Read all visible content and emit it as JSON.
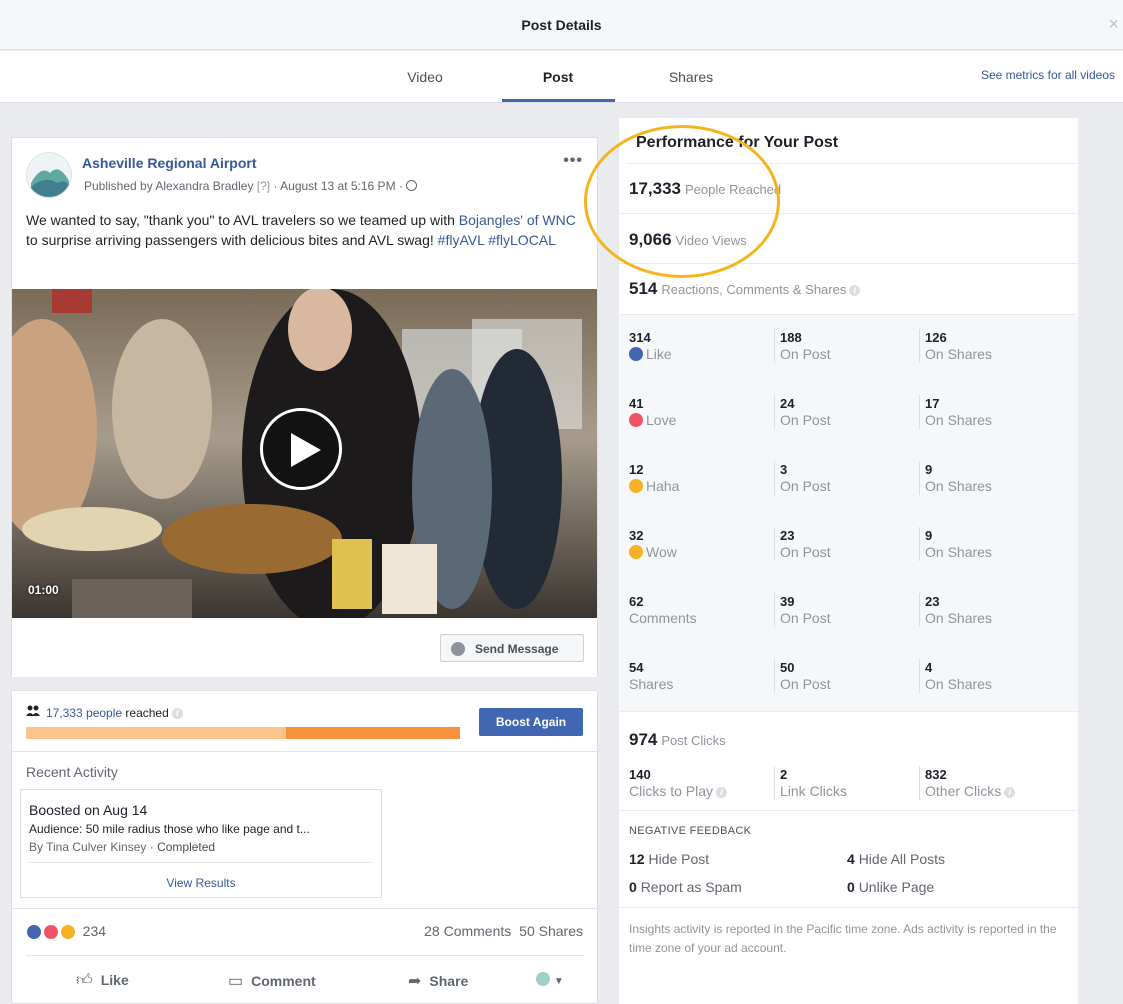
{
  "dialog": {
    "title": "Post Details",
    "close_symbol": "×",
    "tabs": [
      {
        "label": "Video"
      },
      {
        "label": "Post"
      },
      {
        "label": "Shares"
      }
    ],
    "see_metrics_link": "See metrics for all videos"
  },
  "post": {
    "page_name": "Asheville Regional Airport",
    "published_by": "Published by Alexandra Bradley",
    "help_marker": "[?]",
    "date": "· August 13 at 5:16 PM ·",
    "text_part1": "We wanted to say, \"thank you\" to AVL travelers so we teamed up with",
    "text_link": "Bojangles' of WNC",
    "text_part2": " to surprise arriving passengers with delicious bites and AVL swag! ",
    "hashtags": "#flyAVL #flyLOCAL",
    "video_duration": "01:00",
    "send_message_label": "Send Message"
  },
  "reach": {
    "people_link": "17,333 people",
    "reached_suffix": " reached",
    "progress_fraction": 0.6,
    "boost_label": "Boost Again"
  },
  "recent_activity": {
    "label": "Recent Activity",
    "title": "Boosted on Aug 14",
    "audience": "Audience: 50 mile radius those who like page and t...",
    "by": "By Tina Culver Kinsey",
    "status": "Completed",
    "view_results": "View Results"
  },
  "engagement": {
    "reaction_total": "234",
    "comments": "28 Comments",
    "shares": "50 Shares",
    "like_label": "Like",
    "comment_label": "Comment",
    "share_label": "Share"
  },
  "performance": {
    "title": "Performance for Your Post",
    "people_reached_value": "17,333",
    "people_reached_label": "People Reached",
    "video_views_value": "9,066",
    "video_views_label": "Video Views",
    "rcs_value": "514",
    "rcs_label": "Reactions, Comments & Shares",
    "breakdown": [
      {
        "total": "314",
        "label": "Like",
        "icon": "like-icon",
        "color": "#4267b2",
        "on_post": "188",
        "on_shares": "126"
      },
      {
        "total": "41",
        "label": "Love",
        "icon": "love-icon",
        "color": "#f25268",
        "on_post": "24",
        "on_shares": "17"
      },
      {
        "total": "12",
        "label": "Haha",
        "icon": "haha-icon",
        "color": "#f7b125",
        "on_post": "3",
        "on_shares": "9"
      },
      {
        "total": "32",
        "label": "Wow",
        "icon": "wow-icon",
        "color": "#f7b125",
        "on_post": "23",
        "on_shares": "9"
      },
      {
        "total": "62",
        "label": "Comments",
        "icon": "",
        "color": "",
        "on_post": "39",
        "on_shares": "23"
      },
      {
        "total": "54",
        "label": "Shares",
        "icon": "",
        "color": "",
        "on_post": "50",
        "on_shares": "4"
      }
    ],
    "on_post_label": "On Post",
    "on_shares_label": "On Shares",
    "post_clicks_value": "974",
    "post_clicks_label": "Post Clicks",
    "clicks": [
      {
        "value": "140",
        "label": "Clicks to Play"
      },
      {
        "value": "2",
        "label": "Link Clicks"
      },
      {
        "value": "832",
        "label": "Other Clicks"
      }
    ],
    "negative_title": "NEGATIVE FEEDBACK",
    "negative": [
      {
        "value": "12",
        "label": "Hide Post"
      },
      {
        "value": "4",
        "label": "Hide All Posts"
      },
      {
        "value": "0",
        "label": "Report as Spam"
      },
      {
        "value": "0",
        "label": "Unlike Page"
      }
    ],
    "footnote": "Insights activity is reported in the Pacific time zone. Ads activity is reported in the time zone of your ad account."
  },
  "colors": {
    "accent": "#4267b2",
    "link": "#365899",
    "highlight_ring": "#f5b41e",
    "progress_light": "#fbc58a",
    "progress_dark": "#f7923b"
  }
}
